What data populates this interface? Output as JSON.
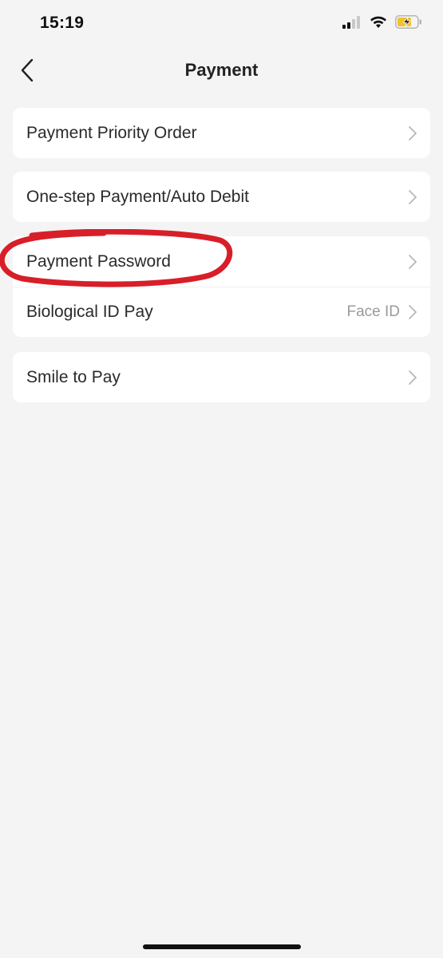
{
  "status_bar": {
    "time": "15:19",
    "icons": [
      "signal-icon",
      "wifi-icon",
      "battery-charging-icon"
    ]
  },
  "nav": {
    "title": "Payment",
    "back_icon": "chevron-left-icon"
  },
  "groups": [
    {
      "rows": [
        {
          "label": "Payment Priority Order",
          "value": ""
        }
      ]
    },
    {
      "rows": [
        {
          "label": "One-step Payment/Auto Debit",
          "value": ""
        }
      ]
    },
    {
      "rows": [
        {
          "label": "Payment Password",
          "value": "",
          "highlighted": true
        },
        {
          "label": "Biological ID Pay",
          "value": "Face ID"
        }
      ]
    },
    {
      "rows": [
        {
          "label": "Smile to Pay",
          "value": ""
        }
      ]
    }
  ],
  "colors": {
    "background": "#f4f4f4",
    "card": "#ffffff",
    "annotation": "#d81e28",
    "battery_fill": "#f2c12e"
  }
}
